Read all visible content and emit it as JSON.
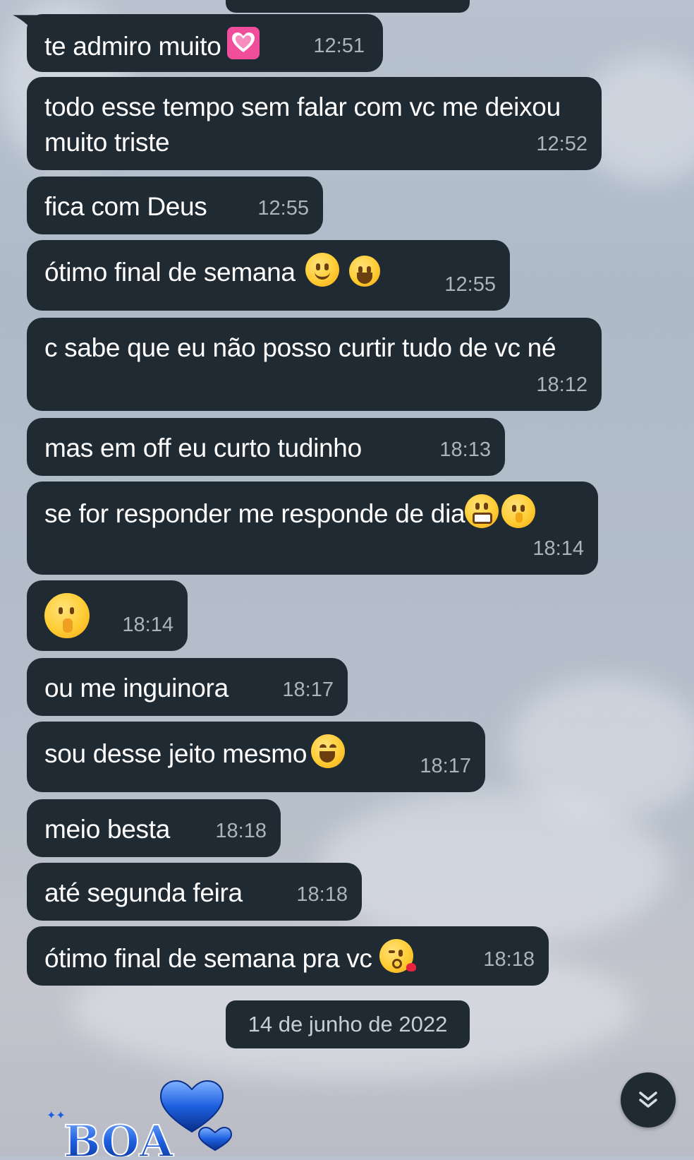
{
  "chat": {
    "messages": [
      {
        "text": "te admiro muito",
        "emoji": "heart-emoji",
        "time": "12:51"
      },
      {
        "text": "todo esse tempo sem falar com vc me deixou muito triste",
        "time": "12:52"
      },
      {
        "text": "fica com Deus",
        "time": "12:55"
      },
      {
        "text": "ótimo final de semana",
        "emoji": "smile-emoji",
        "time": "12:55"
      },
      {
        "text": "c sabe que eu não posso curtir tudo de vc né",
        "time": "18:12"
      },
      {
        "text": "mas em off eu curto tudinho",
        "time": "18:13"
      },
      {
        "text": "se for responder me responde de dia",
        "emoji": "grimace-shush-emoji",
        "time": "18:14"
      },
      {
        "text": "",
        "emoji": "shush-emoji",
        "time": "18:14"
      },
      {
        "text": "ou me inguinora",
        "time": "18:17"
      },
      {
        "text": "sou desse jeito mesmo",
        "emoji": "tears-of-joy-emoji",
        "time": "18:17"
      },
      {
        "text": "meio besta",
        "time": "18:18"
      },
      {
        "text": "até segunda feira",
        "time": "18:18"
      },
      {
        "text": "ótimo final de semana pra vc",
        "emoji": "kiss-emoji",
        "time": "18:18"
      }
    ],
    "date_separator": "14 de junho de 2022",
    "sticker_text": "BOA"
  },
  "colors": {
    "bubble": "#1f2a33",
    "text": "#ffffff",
    "time": "#aab4bc",
    "sticker": "#1d5fe0"
  }
}
